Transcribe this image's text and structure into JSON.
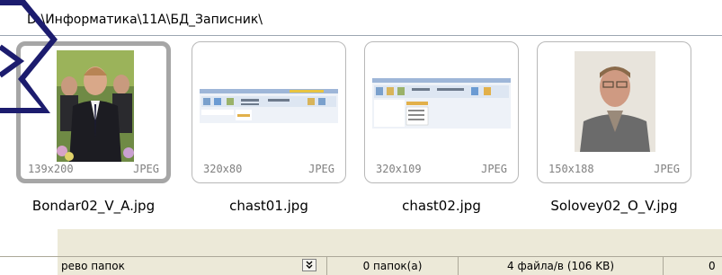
{
  "address": {
    "path": "D:\\Информатика\\11А\\БД_Записник\\"
  },
  "thumbnails": [
    {
      "dims": "139x200",
      "type": "JPEG",
      "name": "Bondar02_V_A.jpg",
      "selected": true
    },
    {
      "dims": "320x80",
      "type": "JPEG",
      "name": "chast01.jpg",
      "selected": false
    },
    {
      "dims": "320x109",
      "type": "JPEG",
      "name": "chast02.jpg",
      "selected": false
    },
    {
      "dims": "150x188",
      "type": "JPEG",
      "name": "Solovey02_O_V.jpg",
      "selected": false
    }
  ],
  "statusbar": {
    "folder_tree_label": "рево папок",
    "folders_count": "0 папок(а)",
    "files_count": "4 файла/в (106 KB)",
    "last": "0"
  },
  "colors": {
    "accent_arrow": "#1c1c6e",
    "statusbar_bg": "#ece9d8",
    "selection_border": "#a6a6a6"
  }
}
